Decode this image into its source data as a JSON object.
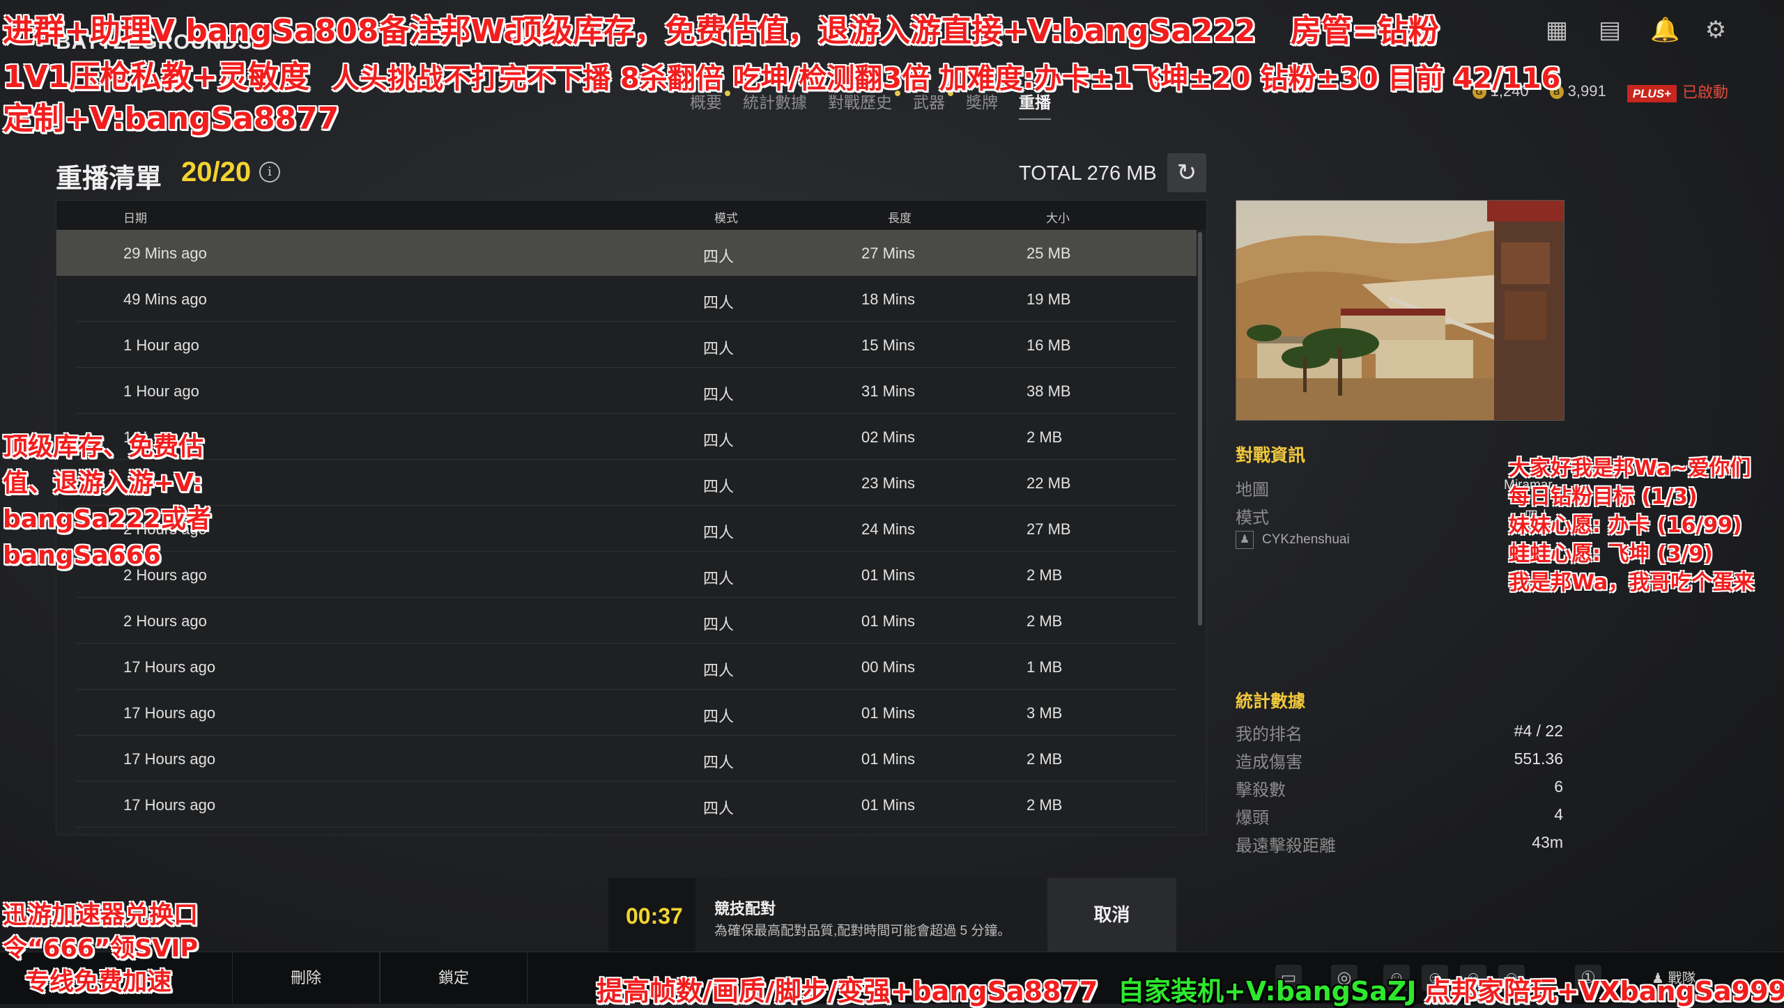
{
  "app": {
    "logo": "BATTLEGROUNDS"
  },
  "nav": {
    "tabs": [
      {
        "label": "概要",
        "dot": true
      },
      {
        "label": "統計數據",
        "dot": false
      },
      {
        "label": "對戰歷史",
        "dot": true
      },
      {
        "label": "武器",
        "dot": true
      },
      {
        "label": "獎牌",
        "dot": false
      },
      {
        "label": "重播",
        "dot": false,
        "active": true
      }
    ]
  },
  "currency": {
    "g_coin": "1,240",
    "bp": "3,991",
    "plus_badge": "PLUS+",
    "plus_status": "已啟動"
  },
  "replays": {
    "title": "重播清單",
    "count": "20/20",
    "total": "TOTAL 276 MB",
    "columns": {
      "date": "日期",
      "mode": "模式",
      "length": "長度",
      "size": "大小"
    },
    "rows": [
      {
        "date": "29 Mins ago",
        "mode": "四人",
        "length": "27 Mins",
        "size": "25 MB"
      },
      {
        "date": "49 Mins ago",
        "mode": "四人",
        "length": "18 Mins",
        "size": "19 MB"
      },
      {
        "date": "1 Hour ago",
        "mode": "四人",
        "length": "15 Mins",
        "size": "16 MB"
      },
      {
        "date": "1 Hour ago",
        "mode": "四人",
        "length": "31 Mins",
        "size": "38 MB"
      },
      {
        "date": "1 H",
        "mode": "四人",
        "length": "02 Mins",
        "size": "2 MB"
      },
      {
        "date": "",
        "mode": "四人",
        "length": "23 Mins",
        "size": "22 MB"
      },
      {
        "date": "2 Hours ago",
        "mode": "四人",
        "length": "24 Mins",
        "size": "27 MB"
      },
      {
        "date": "2 Hours ago",
        "mode": "四人",
        "length": "01 Mins",
        "size": "2 MB"
      },
      {
        "date": "2 Hours ago",
        "mode": "四人",
        "length": "01 Mins",
        "size": "2 MB"
      },
      {
        "date": "17 Hours ago",
        "mode": "四人",
        "length": "00 Mins",
        "size": "1 MB"
      },
      {
        "date": "17 Hours ago",
        "mode": "四人",
        "length": "01 Mins",
        "size": "3 MB"
      },
      {
        "date": "17 Hours ago",
        "mode": "四人",
        "length": "01 Mins",
        "size": "2 MB"
      },
      {
        "date": "17 Hours ago",
        "mode": "四人",
        "length": "01 Mins",
        "size": "2 MB"
      }
    ]
  },
  "match_info": {
    "heading": "對戰資訊",
    "map_label": "地圖",
    "map_value": "Miramar",
    "mode_label": "模式",
    "mode_value": "四人",
    "player": "CYKzhenshuai"
  },
  "stats": {
    "heading": "統計數據",
    "items": [
      {
        "label": "我的排名",
        "value": "#4 / 22"
      },
      {
        "label": "造成傷害",
        "value": "551.36"
      },
      {
        "label": "擊殺數",
        "value": "6"
      },
      {
        "label": "爆頭",
        "value": "4"
      },
      {
        "label": "最遠擊殺距離",
        "value": "43m"
      }
    ]
  },
  "matchmaking": {
    "timer": "00:37",
    "title": "競技配對",
    "desc": "為確保最高配對品質,配對時間可能會超過 5 分鐘。",
    "cancel": "取消"
  },
  "bottom": {
    "delete": "刪除",
    "lock": "鎖定",
    "queue": "戰隊"
  },
  "overlays": {
    "top_line": "进群+助理V bangSa808备注邦Wa",
    "top_yellow": "顶级库存，免费估值，退游入游直接+V:bangSa222",
    "top_right": "房管=钻粉",
    "line2_left": "1V1压枪私教+灵敏度",
    "line2_right": "人头挑战不打完不下播 8杀翻倍 吃坤/检测翻3倍 加难度:办卡±1飞坤±20 钻粉±30 目前 42/116",
    "line3_left": "定制+V:bangSa8877",
    "left_mid": [
      "顶级库存、免费估",
      "值、退游入游+V:",
      "bangSa222或者",
      "bangSa666"
    ],
    "right_mid": [
      "大家好我是邦Wa~爱你们",
      "每日钻粉目标 (1/3)",
      "妹妹心愿: 办卡 (16/99)",
      "蛙蛙心愿: 飞坤 (3/9)",
      "我是邦Wa，我哥吃个蛋来"
    ],
    "bottom_left": [
      "迅游加速器兑换口",
      "令“666”领SVIP",
      "专线免费加速"
    ],
    "bottom_1": "提高帧数/画质/脚步/变强+bangSa8877",
    "bottom_2": "自家装机+V:bangSaZJ",
    "bottom_3": "点邦家陪玩+VXbangSa999"
  }
}
